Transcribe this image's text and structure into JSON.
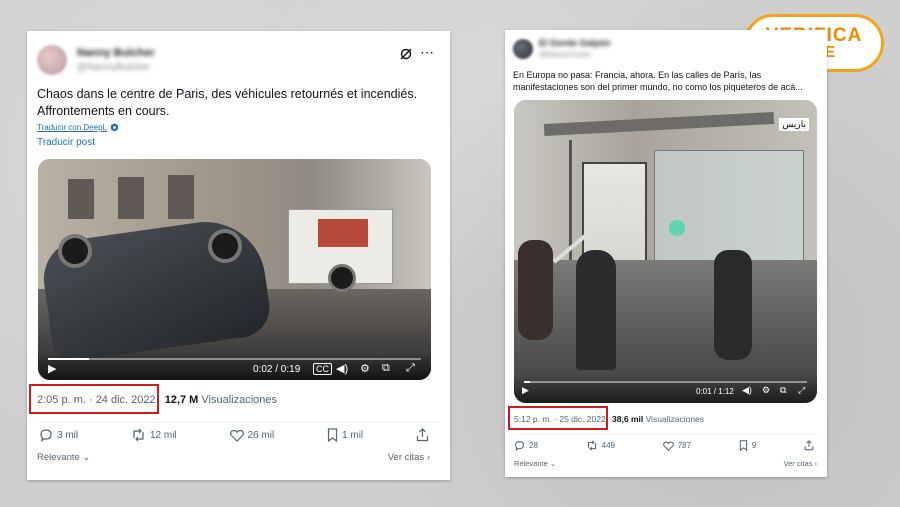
{
  "brand": {
    "line1": "VERIFICA",
    "line2": "RTVE",
    "accent": "#f08a00"
  },
  "highlight_color": "#d3181e",
  "tweet1": {
    "author_name": "Nanny Bulcher",
    "author_handle": "@NannyBulcher",
    "text_line1": "Chaos dans le centre de Paris, des véhicules retournés et incendiés.",
    "text_line2": "Affrontements en cours.",
    "translated_by": "Traducir con DeepL",
    "translate_post": "Traducir post",
    "video_time": "0:02 / 0:19",
    "timestamp": "2:05 p. m. · 24 dic. 2022",
    "views_count": "12,7 M",
    "views_label": "Visualizaciones",
    "video_progress": 0.11,
    "replies": "3 mil",
    "reposts": "12 mil",
    "likes": "26 mil",
    "bookmarks": "1 mil",
    "sort_label": "Relevante",
    "quotes_label": "Ver citas"
  },
  "tweet2": {
    "author_name": "El Gordo Galpón",
    "author_handle": "@NavarGordo",
    "text_line1": "En Europa no pasa: Francia, ahora. En las calles de París, las",
    "text_line2": "manifestaciones son del primer mundo, no como los piqueteros de acá...",
    "video_tag": "باريس",
    "video_time": "0:01 / 1:12",
    "timestamp": "5:12 p. m. · 25 dic. 2022",
    "views_count": "38,6 mil",
    "views_label": "Visualizaciones",
    "video_progress": 0.02,
    "replies": "28",
    "reposts": "449",
    "likes": "787",
    "bookmarks": "9",
    "sort_label": "Relevante",
    "quotes_label": "Ver citas"
  }
}
